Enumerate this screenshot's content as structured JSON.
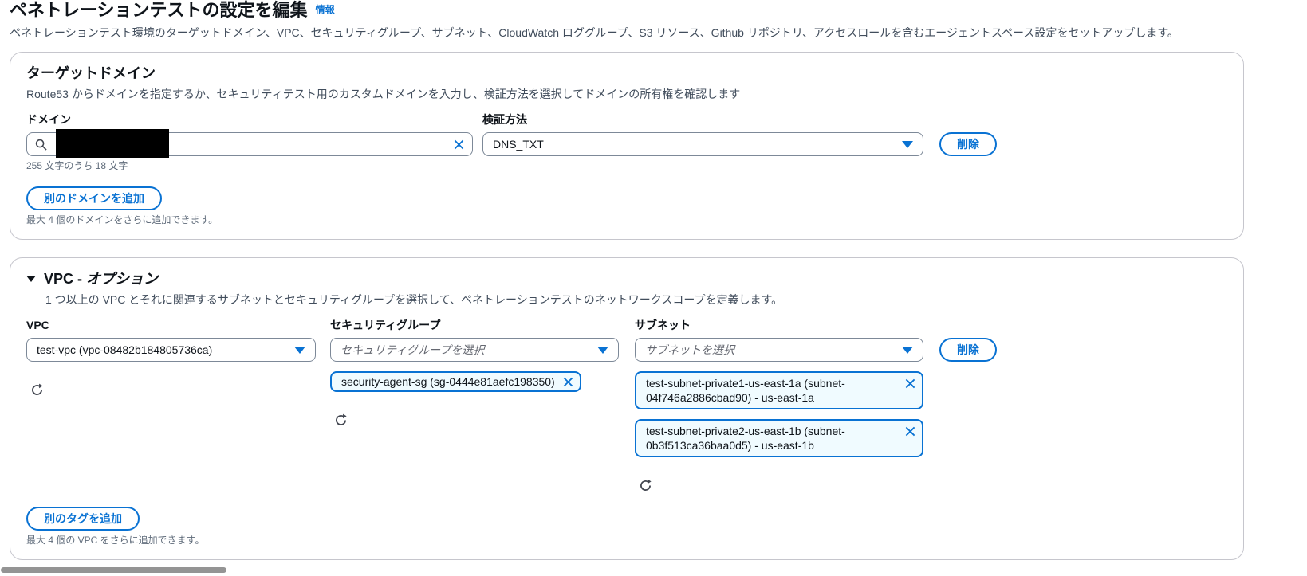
{
  "colors": {
    "accent": "#0972d3",
    "token_bg": "#f0fbff",
    "border_gray": "#7d8998"
  },
  "header": {
    "title": "ペネトレーションテストの設定を編集",
    "info_link": "情報",
    "description": "ペネトレーションテスト環境のターゲットドメイン、VPC、セキュリティグループ、サブネット、CloudWatch ロググループ、S3 リソース、Github リポジトリ、アクセスロールを含むエージェントスペース設定をセットアップします。"
  },
  "domain_section": {
    "title": "ターゲットドメイン",
    "description": "Route53 からドメインを指定するか、セキュリティテスト用のカスタムドメインを入力し、検証方法を選択してドメインの所有権を確認します",
    "domain_label": "ドメイン",
    "char_count": "255 文字のうち 18 文字",
    "verification_label": "検証方法",
    "verification_value": "DNS_TXT",
    "delete_button": "削除",
    "add_button": "別のドメインを追加",
    "add_hint": "最大 4 個のドメインをさらに追加できます。"
  },
  "vpc_section": {
    "title_main": "VPC - ",
    "title_italic": "オプション",
    "description": "1 つ以上の VPC とそれに関連するサブネットとセキュリティグループを選択して、ペネトレーションテストのネットワークスコープを定義します。",
    "vpc_label": "VPC",
    "vpc_value": "test-vpc (vpc-08482b184805736ca)",
    "sg_label": "セキュリティグループ",
    "sg_placeholder": "セキュリティグループを選択",
    "sg_tokens": [
      "security-agent-sg (sg-0444e81aefc198350)"
    ],
    "subnet_label": "サブネット",
    "subnet_placeholder": "サブネットを選択",
    "subnet_tokens": [
      "test-subnet-private1-us-east-1a (subnet-04f746a2886cbad90) - us-east-1a",
      "test-subnet-private2-us-east-1b (subnet-0b3f513ca36baa0d5) - us-east-1b"
    ],
    "delete_button": "削除",
    "add_button": "別のタグを追加",
    "add_hint": "最大 4 個の VPC をさらに追加できます。"
  }
}
